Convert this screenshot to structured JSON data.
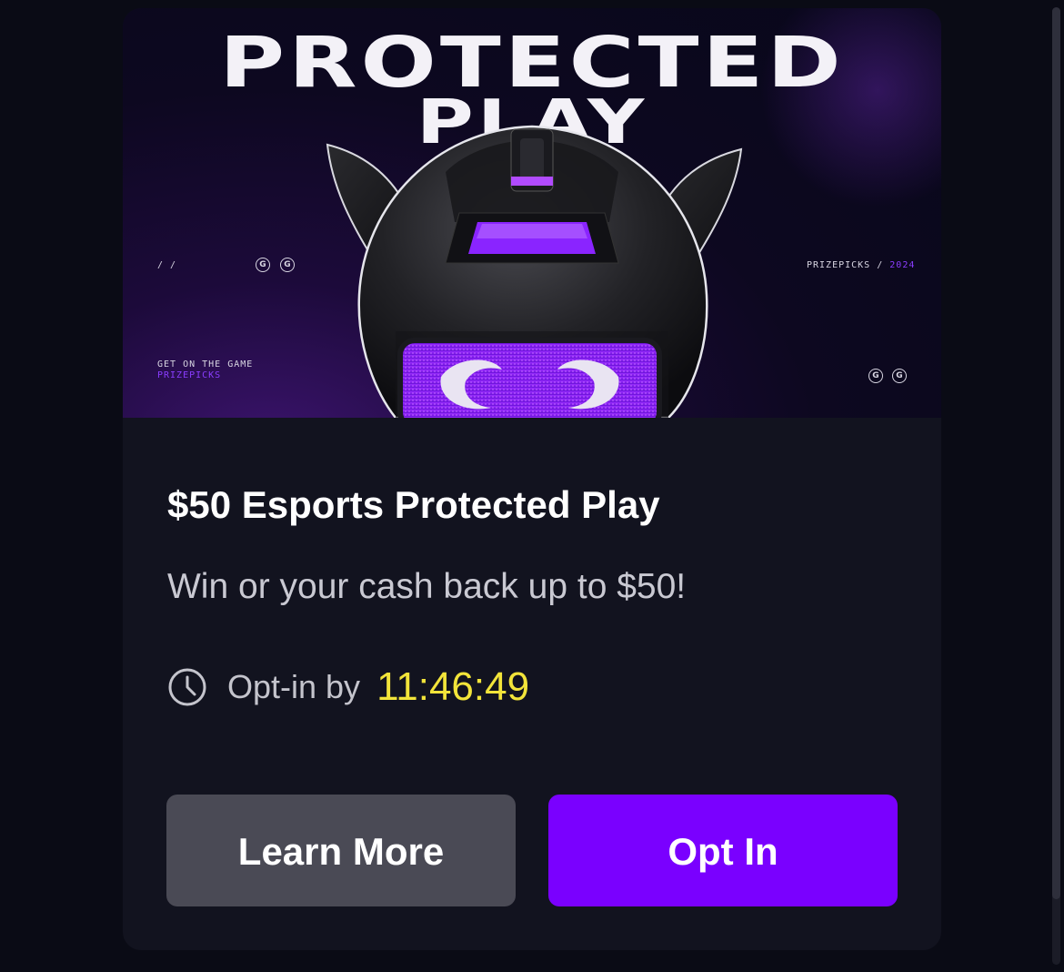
{
  "banner": {
    "title_line1": "PROTECTED",
    "title_line2": "PLAY",
    "slashes": "/ /",
    "badge_letter": "G",
    "brand": "PRIZEPICKS",
    "brand_sep": " / ",
    "year": "2024",
    "tagline": "GET ON THE GAME",
    "tagline_brand": "PRIZEPICKS"
  },
  "promo": {
    "title": "$50 Esports Protected Play",
    "subtitle": "Win or your cash back up to $50!",
    "optin_label": "Opt-in by",
    "countdown": "11:46:49"
  },
  "buttons": {
    "learn_more": "Learn More",
    "opt_in": "Opt In"
  },
  "colors": {
    "background": "#0a0b15",
    "card": "#12131f",
    "accent_purple": "#7a00ff",
    "secondary_button": "#4a4a55",
    "countdown_yellow": "#f2e43a"
  },
  "icons": {
    "clock": "clock-icon",
    "mascot": "horned-robot-mascot"
  }
}
